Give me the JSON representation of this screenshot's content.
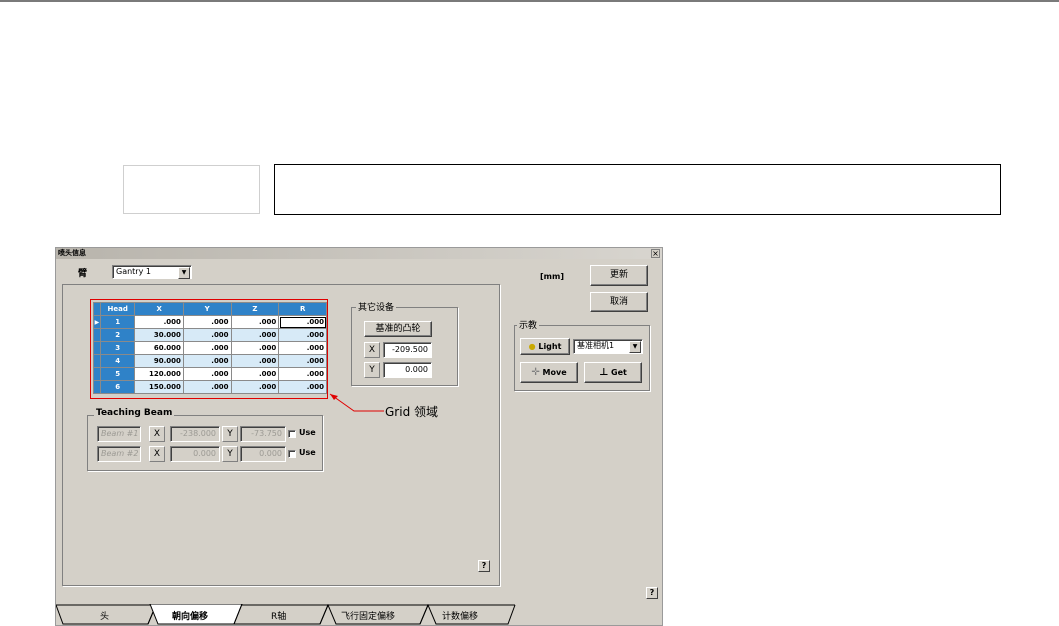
{
  "dialog": {
    "title": "喷头信息",
    "close_label": "×",
    "arm_label": "臂",
    "gantry_select": "Gantry 1",
    "unit_label": "[mm]",
    "update_button": "更新",
    "cancel_button": "取消",
    "help_label": "?"
  },
  "grid": {
    "columns": [
      "Head",
      "X",
      "Y",
      "Z",
      "R"
    ],
    "rows": [
      [
        "1",
        ".000",
        ".000",
        ".000",
        ".000"
      ],
      [
        "2",
        "30.000",
        ".000",
        ".000",
        ".000"
      ],
      [
        "3",
        "60.000",
        ".000",
        ".000",
        ".000"
      ],
      [
        "4",
        "90.000",
        ".000",
        ".000",
        ".000"
      ],
      [
        "5",
        "120.000",
        ".000",
        ".000",
        ".000"
      ],
      [
        "6",
        "150.000",
        ".000",
        ".000",
        ".000"
      ]
    ],
    "current_row_marker": "▶"
  },
  "annotation": {
    "label": "Grid 领域",
    "color": "#e00000"
  },
  "other_devices": {
    "title": "其它设备",
    "button": "基准的凸轮",
    "x_label": "X",
    "x_value": "-209.500",
    "y_label": "Y",
    "y_value": "0.000"
  },
  "teaching_beam": {
    "title": "Teaching Beam",
    "beams": [
      {
        "name": "Beam #1",
        "x_label": "X",
        "x_value": "-238.000",
        "y_label": "Y",
        "y_value": "-73.750",
        "use_label": "Use"
      },
      {
        "name": "Beam #2",
        "x_label": "X",
        "x_value": "0.000",
        "y_label": "Y",
        "y_value": "0.000",
        "use_label": "Use"
      }
    ]
  },
  "teach": {
    "title": "示教",
    "light_button": "Light",
    "camera_select": "基准相机1",
    "move_button": "Move",
    "get_button": "Get",
    "light_icon": "light-bulb-icon",
    "move_icon": "move-arrows-icon",
    "get_icon": "get-nozzle-icon"
  },
  "tabs": [
    "头",
    "朝向偏移",
    "R轴",
    "飞行固定偏移",
    "计数偏移"
  ],
  "active_tab": "朝向偏移",
  "colors": {
    "grid_header": "#2f82c8",
    "grid_alt_row": "#d7eaf7",
    "dialog_face": "#d4d0c8",
    "highlight": "#e00000"
  }
}
